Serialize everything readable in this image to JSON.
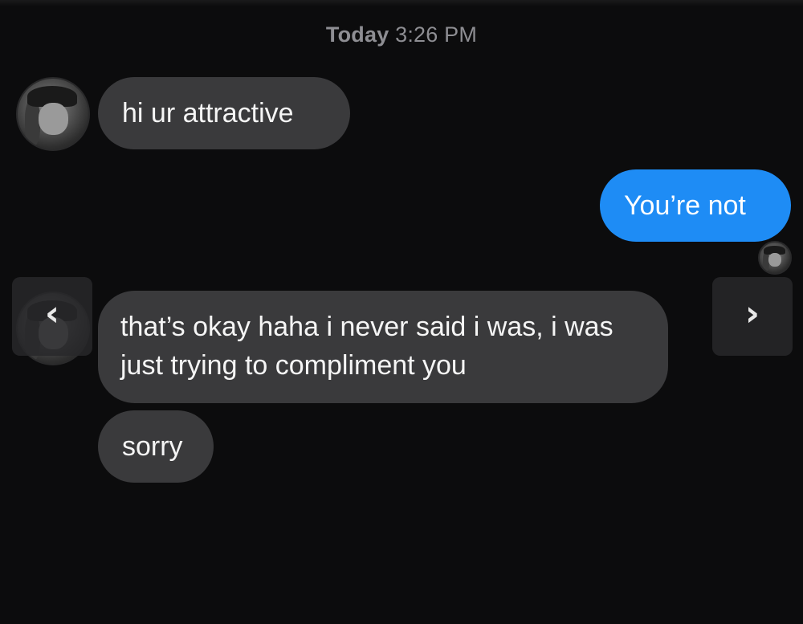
{
  "header": {
    "day": "Today",
    "time": "3:26 PM"
  },
  "messages": [
    {
      "direction": "received",
      "text": "hi ur attractive"
    },
    {
      "direction": "sent",
      "text": "You’re not"
    },
    {
      "direction": "received",
      "text": "that’s okay haha i never said i was, i was just trying to compliment you"
    },
    {
      "direction": "received",
      "text": "sorry"
    }
  ],
  "navigation": {
    "prev_icon": "‹",
    "next_icon": "›"
  },
  "colors": {
    "background": "#0c0c0d",
    "received_bubble": "#3a3a3c",
    "sent_bubble": "#1e8cf5",
    "timestamp": "#8e8e93"
  }
}
